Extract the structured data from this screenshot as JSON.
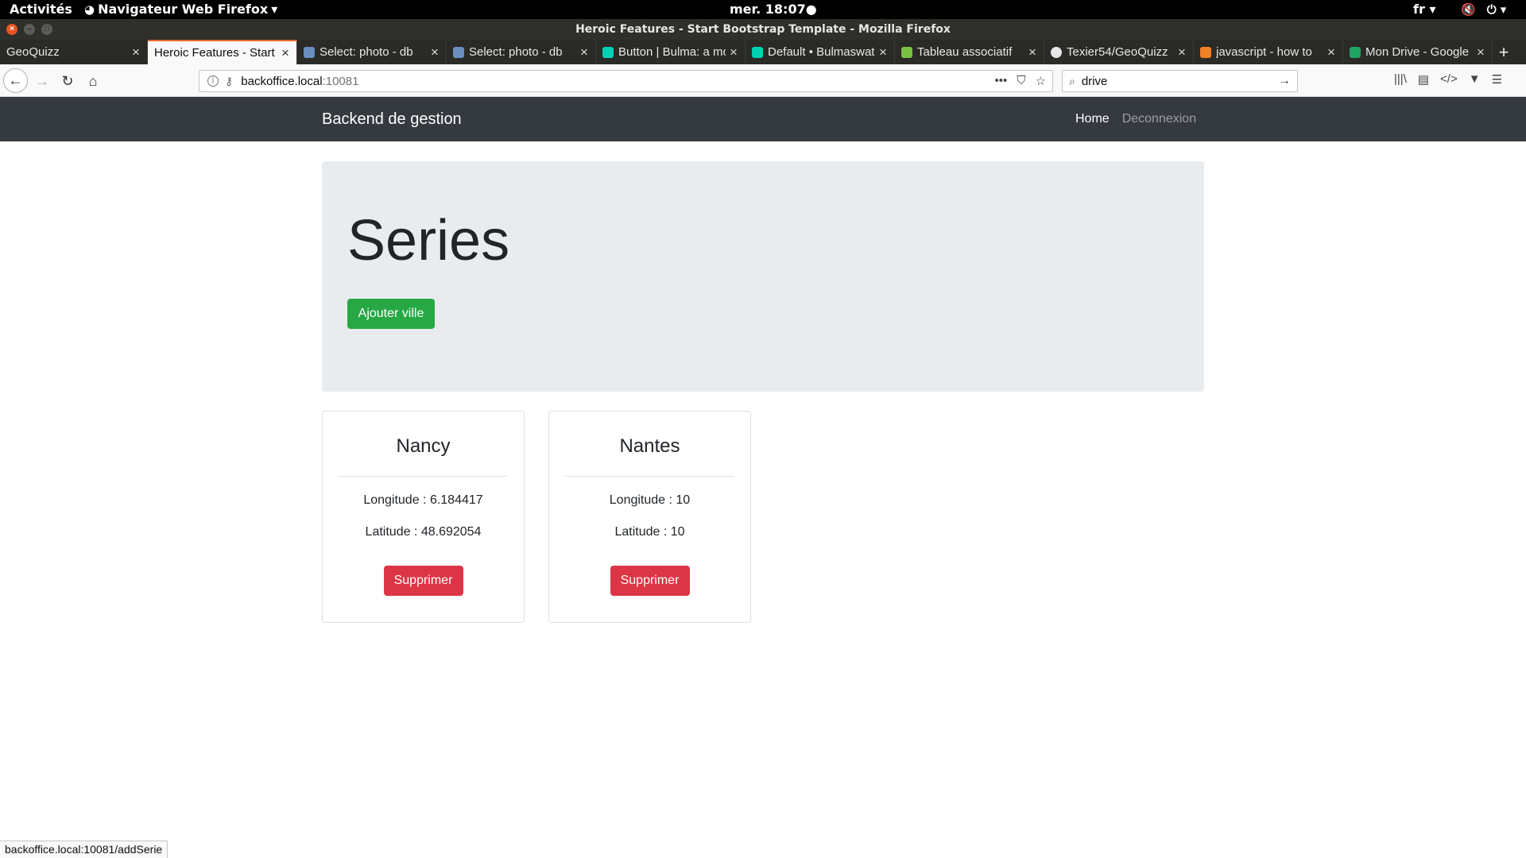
{
  "system_bar": {
    "activities": "Activités",
    "app_name": "Navigateur Web Firefox",
    "clock": "mer. 18:07●",
    "lang": "fr"
  },
  "window": {
    "title": "Heroic Features - Start Bootstrap Template - Mozilla Firefox"
  },
  "tabs": [
    {
      "label": "GeoQuizz",
      "favicon_color": "",
      "active": false
    },
    {
      "label": "Heroic Features - Start Bootstrap Template",
      "favicon_color": "",
      "active": true
    },
    {
      "label": "Select: photo - db",
      "favicon_color": "#6a8fbf",
      "active": false
    },
    {
      "label": "Select: photo - db",
      "favicon_color": "#6a8fbf",
      "active": false
    },
    {
      "label": "Button | Bulma: a modern CSS framework",
      "favicon_color": "#00d1b2",
      "active": false
    },
    {
      "label": "Default • Bulmaswatch",
      "favicon_color": "#00d1b2",
      "active": false
    },
    {
      "label": "Tableau associatif",
      "favicon_color": "#7ac142",
      "active": false
    },
    {
      "label": "Texier54/GeoQuizz",
      "favicon_color": "#e6e6e6",
      "active": false
    },
    {
      "label": "javascript - how to",
      "favicon_color": "#f48024",
      "active": false
    },
    {
      "label": "Mon Drive - Google Drive",
      "favicon_color": "#1fa463",
      "active": false
    }
  ],
  "toolbar": {
    "url_host": "backoffice.local",
    "url_port": ":10081",
    "search_value": "drive"
  },
  "site": {
    "brand": "Backend de gestion",
    "nav_home": "Home",
    "nav_logout": "Deconnexion",
    "heading": "Series",
    "add_button": "Ajouter ville"
  },
  "cards": [
    {
      "title": "Nancy",
      "longitude": "Longitude : 6.184417",
      "latitude": "Latitude : 48.692054",
      "delete_label": "Supprimer"
    },
    {
      "title": "Nantes",
      "longitude": "Longitude : 10",
      "latitude": "Latitude : 10",
      "delete_label": "Supprimer"
    }
  ],
  "status_bar": {
    "link": "backoffice.local:10081/addSerie"
  },
  "colors": {
    "navbar": "#343a40",
    "jumbotron": "#e9ecef",
    "success": "#28a745",
    "danger": "#dc3545"
  }
}
